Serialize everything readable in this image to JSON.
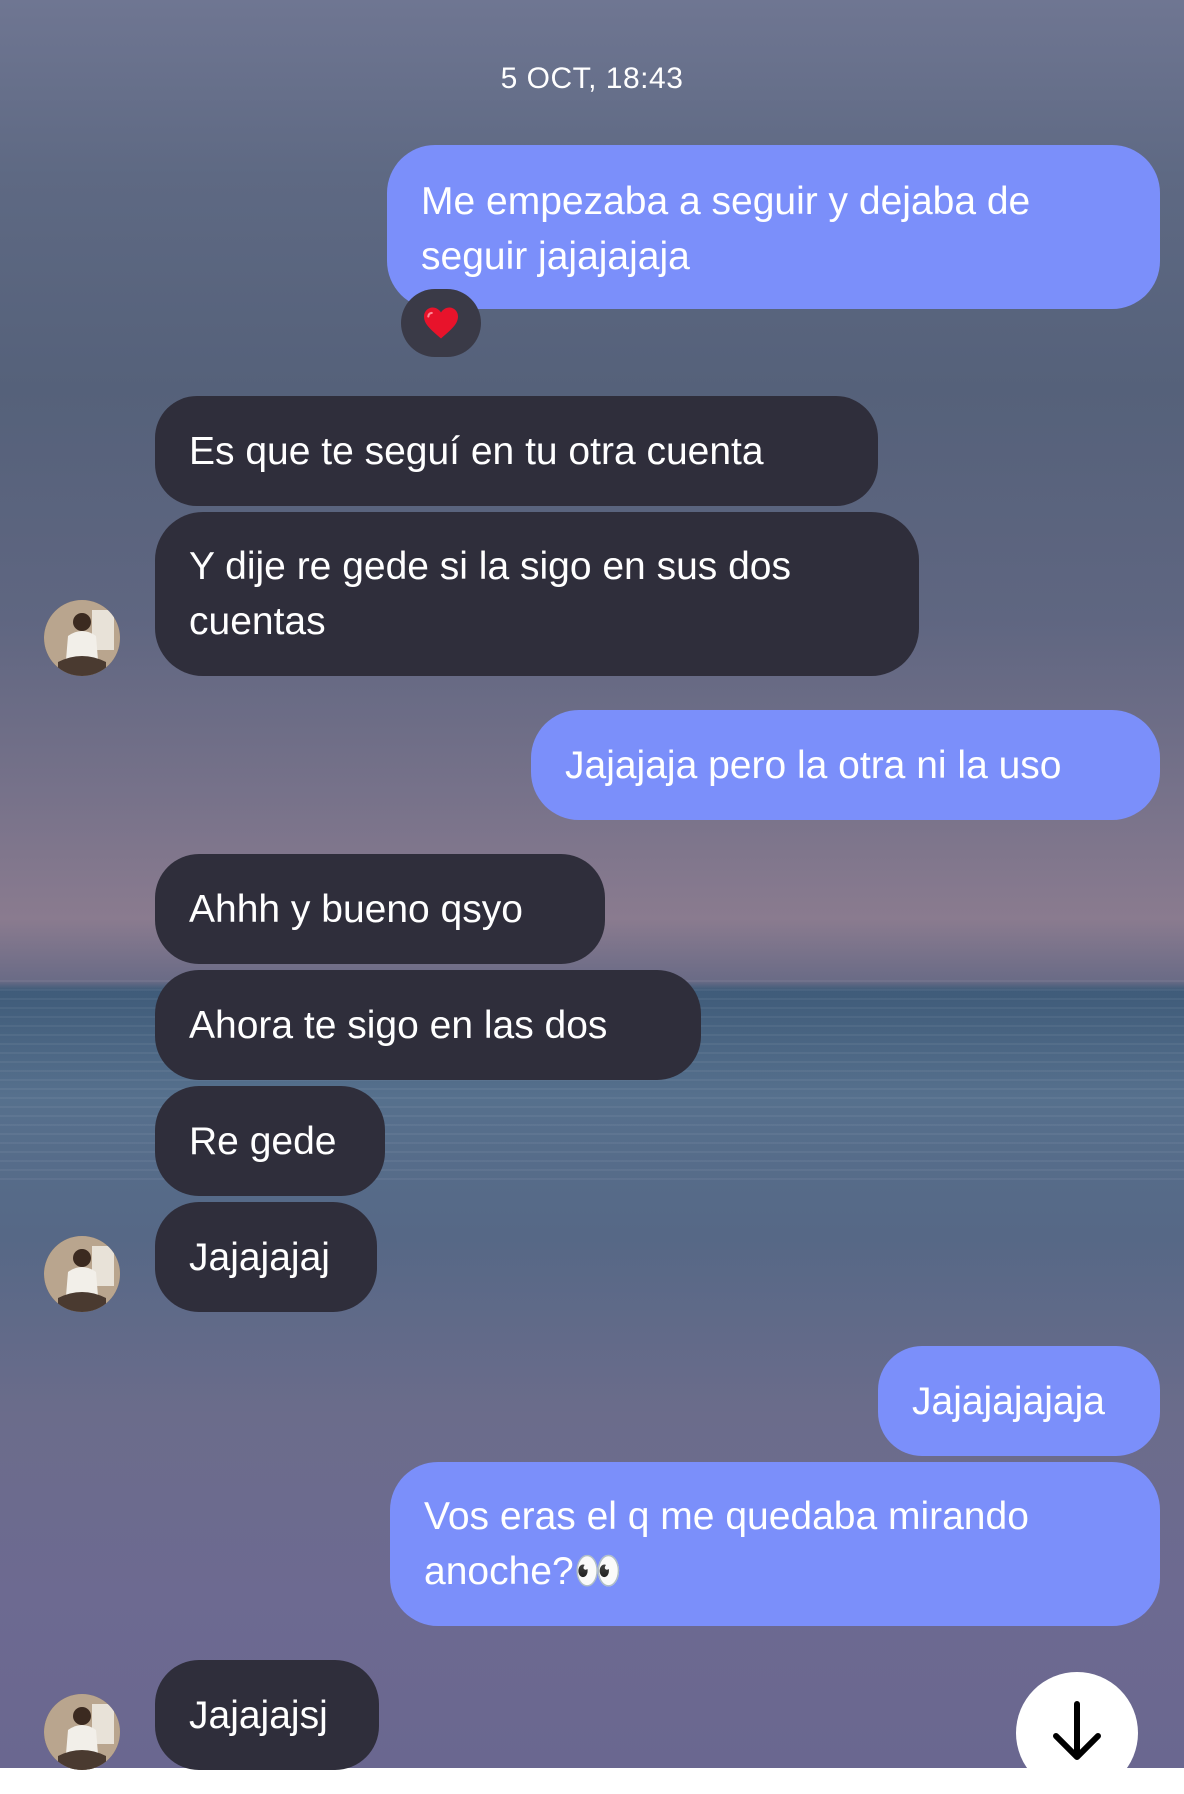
{
  "thread": {
    "timestamp": "5 OCT, 18:43",
    "messages": [
      {
        "from": "me",
        "text": "Me empezaba a seguir y dejaba de seguir jajajajaja",
        "reaction": "heart"
      },
      {
        "from": "them",
        "text": "Es que te seguí en tu otra cuenta"
      },
      {
        "from": "them",
        "text": "Y dije re gede si la sigo en sus dos cuentas"
      },
      {
        "from": "me",
        "text": "Jajajaja pero la otra ni la uso"
      },
      {
        "from": "them",
        "text": "Ahhh y bueno qsyo"
      },
      {
        "from": "them",
        "text": "Ahora te sigo en las dos"
      },
      {
        "from": "them",
        "text": "Re gede"
      },
      {
        "from": "them",
        "text": "Jajajajaj"
      },
      {
        "from": "me",
        "text": "Jajajajajaja"
      },
      {
        "from": "me",
        "text": "Vos eras el q me quedaba mirando anoche?👀"
      },
      {
        "from": "them",
        "text": "Jajajajsj"
      }
    ]
  },
  "icons": {
    "reaction": "heart-icon",
    "scroll": "arrow-down-icon",
    "avatar": "contact-avatar"
  },
  "colors": {
    "outgoing_bubble": "#7b8ffa",
    "incoming_bubble": "#2f2e3b",
    "text": "#ffffff"
  }
}
